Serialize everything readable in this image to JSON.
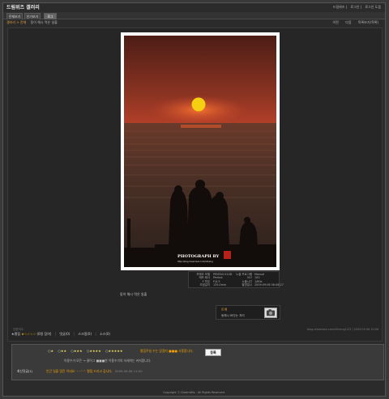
{
  "app": {
    "title": "드림위즈 갤러리",
    "top_links": [
      "드림위즈",
      "로그인",
      "로그인 도움"
    ]
  },
  "tabs": [
    {
      "label": "전체보기"
    },
    {
      "label": "인기보기"
    },
    {
      "label": "로그"
    }
  ],
  "breadcrumb": {
    "home": "갤러리 > 전체",
    "current": "동이 해시 먹은 일출"
  },
  "nav": {
    "prev": "이전",
    "next": "다음",
    "list": "목록보기(목록)"
  },
  "photo": {
    "watermark": "PHOTOGRAPH BY",
    "watermark_url": "http://blog.dreamwiz.com/hiiheng",
    "colors": {
      "sky_top": "#5a2218",
      "sky_mid": "#c8462c",
      "sun": "#f5d010",
      "sea": "#3a2820"
    }
  },
  "exif": {
    "rows": [
      {
        "k": "카메라 모델",
        "v": "PENTAX K10D",
        "k2": "노출 프로그램",
        "v2": "Manual"
      },
      {
        "k": "제조 회사",
        "v": "Pentax",
        "k2": "ISO",
        "v2": "100"
      },
      {
        "k": "F 번호",
        "v": "F/4.5",
        "k2": "노출시간",
        "v2": "1/80s"
      },
      {
        "k": "초점길이",
        "v": "135.0mm",
        "k2": "촬영일시",
        "v2": "2009:09:06 06:06:27"
      }
    ]
  },
  "description": "동이 해시 먹은 일출",
  "trackback": {
    "label": "트랙",
    "text": "동해시 바닷는 처리"
  },
  "meta_left": "관련자수",
  "meta_right": "blog.dreamwiz.com/hiiheng/123  |  2009.09.06 10:46",
  "action_bar": {
    "rating_label": "★평점",
    "rating_stars": "★☆☆☆☆",
    "rating_count": "(0명 참여)",
    "comments": "댓글(0)",
    "scrap": "스크랩(0)",
    "share": "소스(0)"
  },
  "rating": {
    "options": [
      {
        "stars": "★",
        "label": "★"
      },
      {
        "stars": "★",
        "label": "★★"
      },
      {
        "stars": "★",
        "label": "★★★"
      },
      {
        "stars": "★",
        "label": "★★★★"
      },
      {
        "stars": "★",
        "label": "★★★★★"
      }
    ],
    "hint": "평점주실 수는 있겠지 ■■■ 사용합니다.",
    "button": "등록",
    "note": "이용수가 모든 → 클어그 ■■■한 이용수가의 자세히는 커지합니다.",
    "latest_label": "최신덧글(1)",
    "latest_text": "인간 일출 멋진 이네요 ~~^^ 평점 드리고 갑니다.",
    "latest_time": "2009.09.06 11:05"
  },
  "footer": {
    "text": "Copyright ⓒ DreamWiz . All Rights Reserved."
  }
}
